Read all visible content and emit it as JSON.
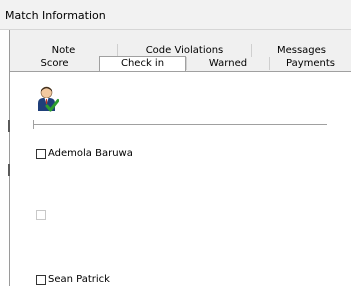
{
  "window": {
    "title": "Match Information"
  },
  "tabs": {
    "row1": [
      "Note",
      "Code Violations",
      "Messages"
    ],
    "row2": [
      "Score",
      "Check in",
      "Warned",
      "Payments"
    ],
    "active": "Check in"
  },
  "checkin": {
    "players": [
      {
        "name": "Ademola Baruwa",
        "checked": false,
        "enabled": true
      },
      {
        "name": "",
        "checked": false,
        "enabled": false
      },
      {
        "name": "Sean Patrick",
        "checked": false,
        "enabled": true
      }
    ]
  },
  "icons": {
    "header": "user-check-icon"
  },
  "colors": {
    "title_bar": "#f2f2f2",
    "tab_strip": "#f0f0f0",
    "active_tab": "#ffffff",
    "icon_check": "#2e9e2e",
    "icon_shirt": "#1f3f7a"
  }
}
